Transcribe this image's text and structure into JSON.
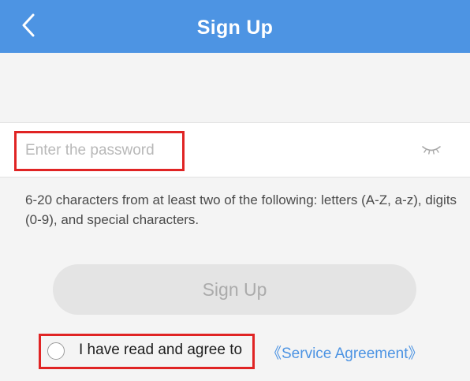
{
  "header": {
    "title": "Sign Up",
    "back_icon": "chevron-left-icon",
    "background": "#4d94e3"
  },
  "password_field": {
    "placeholder": "Enter the password",
    "value": "",
    "toggle_icon": "eye-closed-icon"
  },
  "hint": {
    "text": "6-20 characters from at least two of the following: letters (A-Z, a-z), digits (0-9), and special characters."
  },
  "signup_button": {
    "label": "Sign Up",
    "state": "disabled"
  },
  "agreement": {
    "checked": false,
    "text": "I have read and agree to",
    "link_text": "《Service Agreement》",
    "link_color": "#4d94e3"
  },
  "highlight_color": "#e02424"
}
